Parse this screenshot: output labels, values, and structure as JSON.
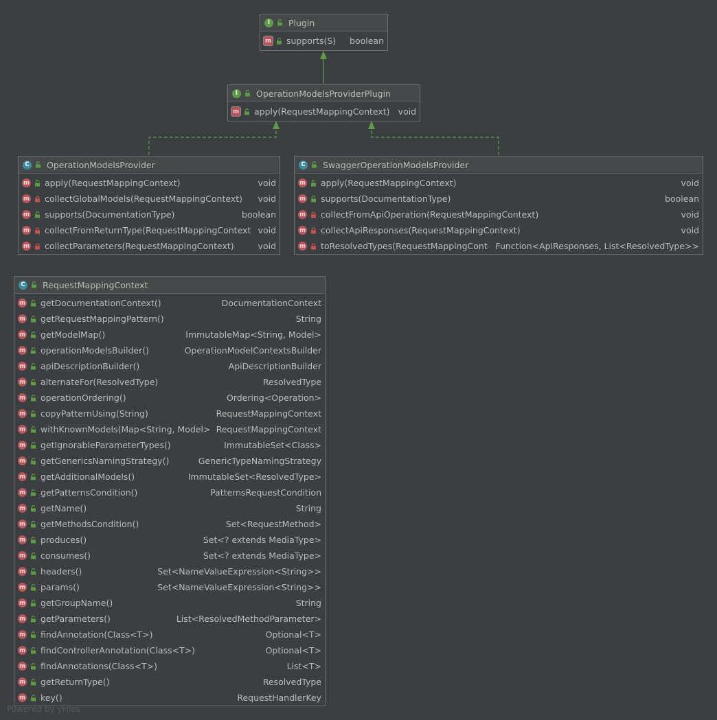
{
  "plugin": {
    "title": "Plugin",
    "kind": "I",
    "members": [
      {
        "name": "supports(S)",
        "type": "boolean",
        "access": "public"
      }
    ]
  },
  "omp_plugin": {
    "title": "OperationModelsProviderPlugin",
    "kind": "I",
    "members": [
      {
        "name": "apply(RequestMappingContext)",
        "type": "void",
        "access": "public"
      }
    ]
  },
  "omp": {
    "title": "OperationModelsProvider",
    "kind": "C",
    "members": [
      {
        "name": "apply(RequestMappingContext)",
        "type": "void",
        "access": "public"
      },
      {
        "name": "collectGlobalModels(RequestMappingContext)",
        "type": "void",
        "access": "private"
      },
      {
        "name": "supports(DocumentationType)",
        "type": "boolean",
        "access": "public"
      },
      {
        "name": "collectFromReturnType(RequestMappingContext)",
        "type": "void",
        "access": "private"
      },
      {
        "name": "collectParameters(RequestMappingContext)",
        "type": "void",
        "access": "private"
      }
    ]
  },
  "somp": {
    "title": "SwaggerOperationModelsProvider",
    "kind": "C",
    "members": [
      {
        "name": "apply(RequestMappingContext)",
        "type": "void",
        "access": "public"
      },
      {
        "name": "supports(DocumentationType)",
        "type": "boolean",
        "access": "public"
      },
      {
        "name": "collectFromApiOperation(RequestMappingContext)",
        "type": "void",
        "access": "private"
      },
      {
        "name": "collectApiResponses(RequestMappingContext)",
        "type": "void",
        "access": "private"
      },
      {
        "name": "toResolvedTypes(RequestMappingContext)",
        "type": "Function<ApiResponses, List<ResolvedType>>",
        "access": "private"
      }
    ]
  },
  "rmc": {
    "title": "RequestMappingContext",
    "kind": "C",
    "members": [
      {
        "name": "getDocumentationContext()",
        "type": "DocumentationContext",
        "access": "public"
      },
      {
        "name": "getRequestMappingPattern()",
        "type": "String",
        "access": "public"
      },
      {
        "name": "getModelMap()",
        "type": "ImmutableMap<String, Model>",
        "access": "public"
      },
      {
        "name": "operationModelsBuilder()",
        "type": "OperationModelContextsBuilder",
        "access": "public"
      },
      {
        "name": "apiDescriptionBuilder()",
        "type": "ApiDescriptionBuilder",
        "access": "public"
      },
      {
        "name": "alternateFor(ResolvedType)",
        "type": "ResolvedType",
        "access": "public"
      },
      {
        "name": "operationOrdering()",
        "type": "Ordering<Operation>",
        "access": "public"
      },
      {
        "name": "copyPatternUsing(String)",
        "type": "RequestMappingContext",
        "access": "public"
      },
      {
        "name": "withKnownModels(Map<String, Model>)",
        "type": "RequestMappingContext",
        "access": "public"
      },
      {
        "name": "getIgnorableParameterTypes()",
        "type": "ImmutableSet<Class>",
        "access": "public"
      },
      {
        "name": "getGenericsNamingStrategy()",
        "type": "GenericTypeNamingStrategy",
        "access": "public"
      },
      {
        "name": "getAdditionalModels()",
        "type": "ImmutableSet<ResolvedType>",
        "access": "public"
      },
      {
        "name": "getPatternsCondition()",
        "type": "PatternsRequestCondition",
        "access": "public"
      },
      {
        "name": "getName()",
        "type": "String",
        "access": "public"
      },
      {
        "name": "getMethodsCondition()",
        "type": "Set<RequestMethod>",
        "access": "public"
      },
      {
        "name": "produces()",
        "type": "Set<? extends MediaType>",
        "access": "public"
      },
      {
        "name": "consumes()",
        "type": "Set<? extends MediaType>",
        "access": "public"
      },
      {
        "name": "headers()",
        "type": "Set<NameValueExpression<String>>",
        "access": "public"
      },
      {
        "name": "params()",
        "type": "Set<NameValueExpression<String>>",
        "access": "public"
      },
      {
        "name": "getGroupName()",
        "type": "String",
        "access": "public"
      },
      {
        "name": "getParameters()",
        "type": "List<ResolvedMethodParameter>",
        "access": "public"
      },
      {
        "name": "findAnnotation(Class<T>)",
        "type": "Optional<T>",
        "access": "public"
      },
      {
        "name": "findControllerAnnotation(Class<T>)",
        "type": "Optional<T>",
        "access": "public"
      },
      {
        "name": "findAnnotations(Class<T>)",
        "type": "List<T>",
        "access": "public"
      },
      {
        "name": "getReturnType()",
        "type": "ResolvedType",
        "access": "public"
      },
      {
        "name": "key()",
        "type": "RequestHandlerKey",
        "access": "public"
      }
    ]
  },
  "method_badge": "m",
  "watermark": "Powered by yFiles",
  "colors": {
    "background": "#3c3f41",
    "interface_badge": "#5d9b47",
    "class_badge": "#3d8ca0",
    "method_badge": "#b7555c",
    "public_icon": "#5d9b47",
    "private_icon": "#c75450",
    "inheritance_edge": "#5d9b47"
  }
}
